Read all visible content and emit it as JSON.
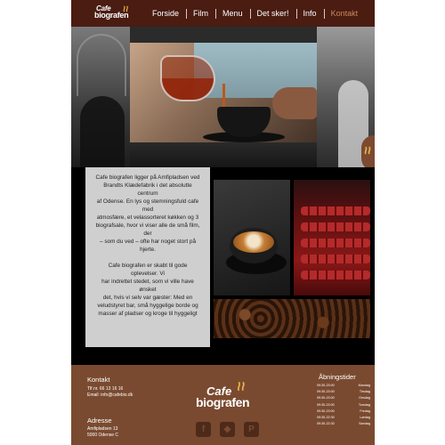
{
  "nav": {
    "logo_top": "Cafe",
    "logo_bottom": "biografen",
    "links": [
      "Forside",
      "Film",
      "Menu",
      "Det sker!",
      "Info",
      "Kontakt"
    ],
    "active": "Kontakt"
  },
  "info": {
    "paragraph1": "Cafe biografen ligger på Amfipladsen ved\nBrandts Klædefabrik i det absolutte\ncentrum\naf Odense. En lys og stemningsfuld cafe\nmed\natmosfære, et velassorteret køkken og 3\nbiografsale,  hvor vi viser alle de små film,\nder\n– som du ved – ofte har noget stort på\nhjerte.",
    "paragraph2": "Cafe biografen er skabt til gode\noplevelser. Vi\nhar indrettet stedet, som vi ville have\nønsket\ndet, hvis vi selv var gæster: Med en\nveludstyret bar, små hyggelige borde og\nmasser af pladser og kroge til hyggeligt"
  },
  "footer": {
    "contact_title": "Kontakt",
    "phone": "Tlf.nr. 66 13 16 16",
    "email": "Email: info@cafebio.dk",
    "address_title": "Adresse",
    "street": "Amfipladsen 13",
    "city": "5000 Odense C",
    "logo_top": "Cafe",
    "logo_bottom": "biografen",
    "social_icons": [
      "facebook-icon",
      "map-icon",
      "parking-icon"
    ],
    "social_glyphs": [
      "f",
      "◆",
      "P"
    ],
    "hours_title": "Åbningstider",
    "hours": [
      {
        "time": "09:30-23:00",
        "day": "Mandag"
      },
      {
        "time": "09:30-23:00",
        "day": "Tirsdag"
      },
      {
        "time": "09:30-23:00",
        "day": "Onsdag"
      },
      {
        "time": "09:30-23:00",
        "day": "Torsdag"
      },
      {
        "time": "09:30-23:00",
        "day": "Fredag"
      },
      {
        "time": "09:30-22:30",
        "day": "Lørdag"
      },
      {
        "time": "09:30-22:30",
        "day": "Søndag"
      }
    ]
  },
  "colors": {
    "nav_bg": "#4a1c12",
    "footer_bg": "#7a4a30",
    "accent": "#c98a5c",
    "textbox_bg": "#cfcfcf"
  }
}
